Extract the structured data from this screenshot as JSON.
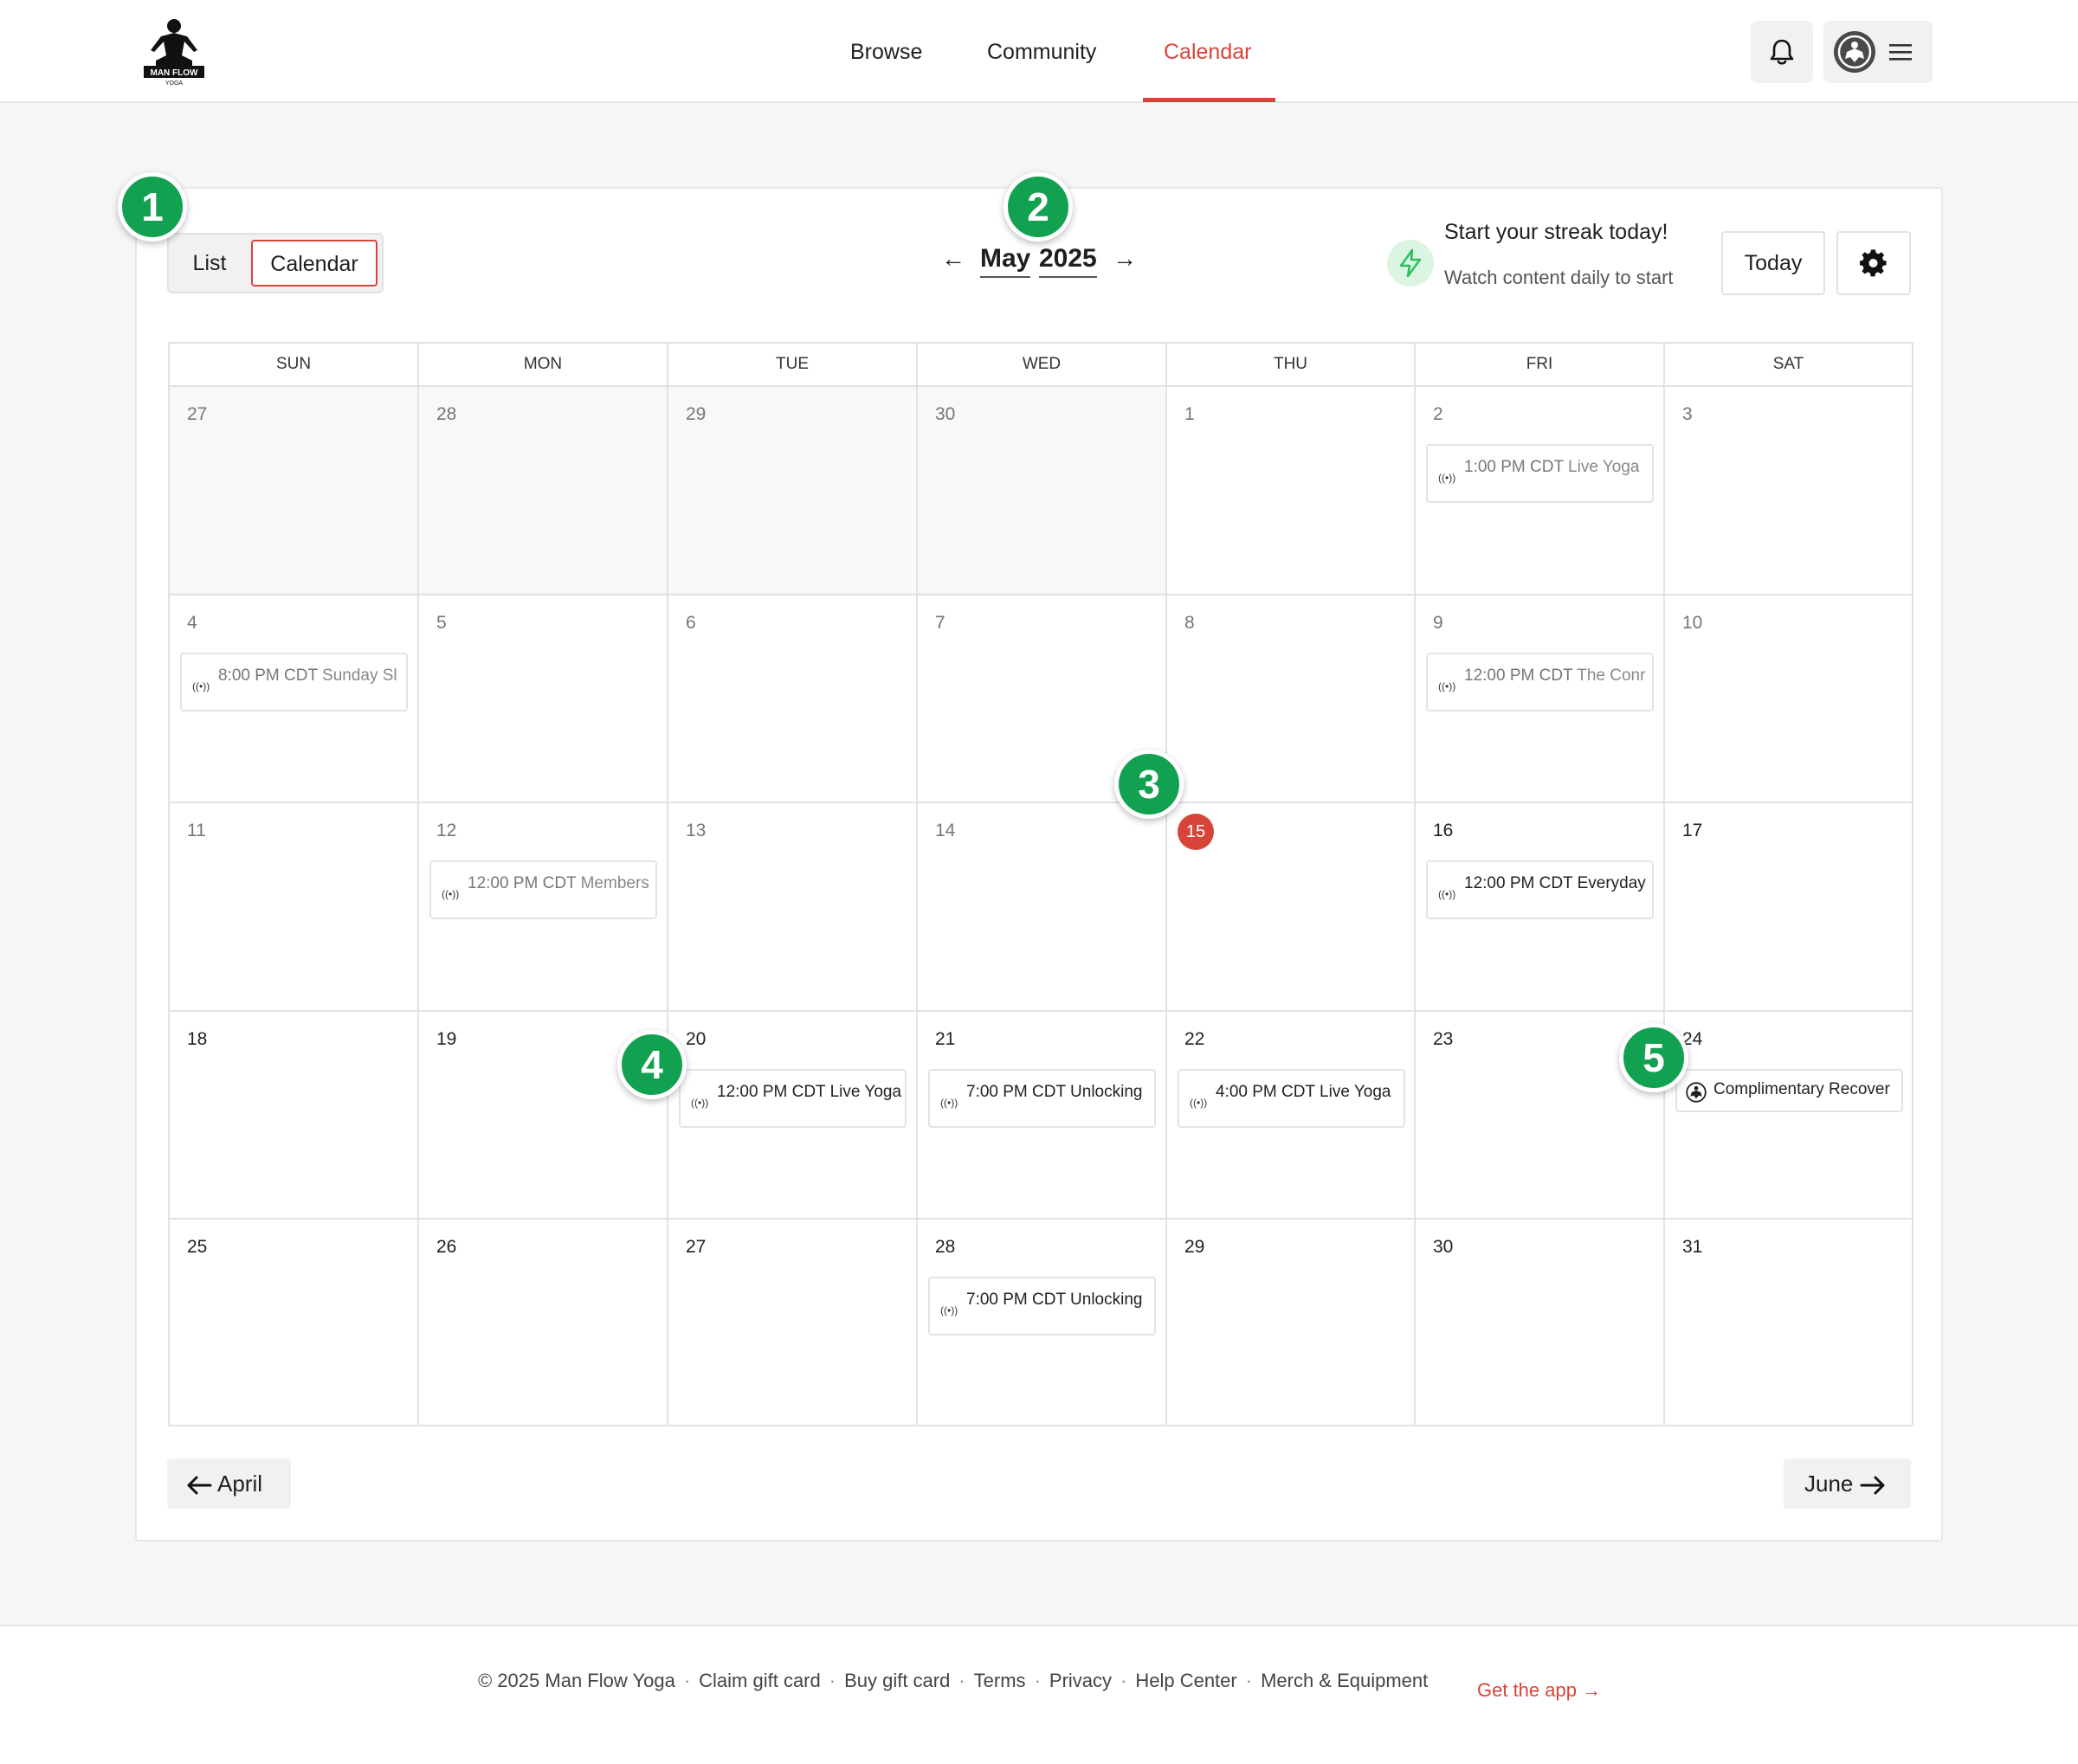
{
  "brand": {
    "logo_text": "MAN FLOW",
    "logo_sub": "YOGA"
  },
  "nav": {
    "browse": "Browse",
    "community": "Community",
    "calendar": "Calendar"
  },
  "view_toggle": {
    "list": "List",
    "calendar": "Calendar"
  },
  "month_nav": {
    "prev_arrow": "←",
    "month": "May",
    "year": "2025",
    "next_arrow": "→"
  },
  "streak": {
    "title": "Start your streak today!",
    "subtitle": "Watch content daily to start"
  },
  "toolbar": {
    "today": "Today"
  },
  "weekdays": [
    "SUN",
    "MON",
    "TUE",
    "WED",
    "THU",
    "FRI",
    "SAT"
  ],
  "days": {
    "d0": "27",
    "d1": "28",
    "d2": "29",
    "d3": "30",
    "d4": "1",
    "d5": "2",
    "d6": "3",
    "d7": "4",
    "d8": "5",
    "d9": "6",
    "d10": "7",
    "d11": "8",
    "d12": "9",
    "d13": "10",
    "d14": "11",
    "d15": "12",
    "d16": "13",
    "d17": "14",
    "d18": "15",
    "d19": "16",
    "d20": "17",
    "d21": "18",
    "d22": "19",
    "d23": "20",
    "d24": "21",
    "d25": "22",
    "d26": "23",
    "d27": "24",
    "d28": "25",
    "d29": "26",
    "d30": "27",
    "d31": "28",
    "d32": "29",
    "d33": "30",
    "d34": "31"
  },
  "events": {
    "e1": {
      "time": "1:00 PM CDT",
      "title": "Live Yoga"
    },
    "e2": {
      "time": "8:00 PM CDT",
      "title": "Sunday Sl"
    },
    "e3": {
      "time": "12:00 PM CDT",
      "title": "The Conr"
    },
    "e4": {
      "time": "12:00 PM CDT",
      "title": "Members"
    },
    "e5": {
      "time": "12:00 PM CDT",
      "title": "Everyday"
    },
    "e6": {
      "time": "12:00 PM CDT",
      "title": "Live Yoga"
    },
    "e7": {
      "time": "7:00 PM CDT",
      "title": "Unlocking"
    },
    "e8": {
      "time": "4:00 PM CDT",
      "title": "Live Yoga"
    },
    "e9": {
      "title": "Complimentary Recover"
    },
    "e10": {
      "time": "7:00 PM CDT",
      "title": "Unlocking"
    }
  },
  "pager": {
    "prev": "April",
    "next": "June"
  },
  "badges": [
    "1",
    "2",
    "3",
    "4",
    "5"
  ],
  "footer": {
    "copyright": "© 2025 Man Flow Yoga",
    "links": [
      "Claim gift card",
      "Buy gift card",
      "Terms",
      "Privacy",
      "Help Center",
      "Merch & Equipment"
    ],
    "separator": "·",
    "get_app": "Get the app →"
  },
  "colors": {
    "accent": "#d9443a",
    "badge": "#12a150",
    "streak": "#2fbf5f"
  }
}
